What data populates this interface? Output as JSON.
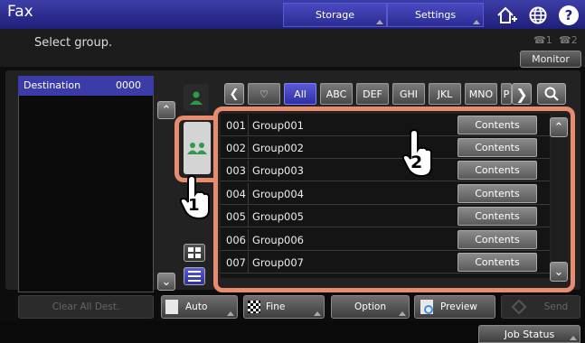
{
  "header": {
    "title": "Fax",
    "storage_label": "Storage",
    "settings_label": "Settings",
    "monitor_label": "Monitor",
    "line1_label": "1",
    "line2_label": "2"
  },
  "message": "Select group.",
  "destination": {
    "label": "Destination",
    "count": "0000"
  },
  "filters": [
    "All",
    "ABC",
    "DEF",
    "GHI",
    "JKL",
    "MNO",
    "P"
  ],
  "selected_filter": "All",
  "groups": [
    {
      "num": "001",
      "name": "Group001",
      "action": "Contents"
    },
    {
      "num": "002",
      "name": "Group002",
      "action": "Contents"
    },
    {
      "num": "003",
      "name": "Group003",
      "action": "Contents"
    },
    {
      "num": "004",
      "name": "Group004",
      "action": "Contents"
    },
    {
      "num": "005",
      "name": "Group005",
      "action": "Contents"
    },
    {
      "num": "006",
      "name": "Group006",
      "action": "Contents"
    },
    {
      "num": "007",
      "name": "Group007",
      "action": "Contents"
    }
  ],
  "bottom": {
    "clear_all": "Clear All Dest.",
    "auto": "Auto",
    "fine": "Fine",
    "option": "Option",
    "preview": "Preview",
    "send": "Send",
    "job_status": "Job Status"
  },
  "callouts": [
    "1",
    "2"
  ],
  "colors": {
    "accent_blue": "#3c3ca8",
    "highlight_orange": "#e98b6f",
    "group_icon_green": "#2e9b48"
  }
}
